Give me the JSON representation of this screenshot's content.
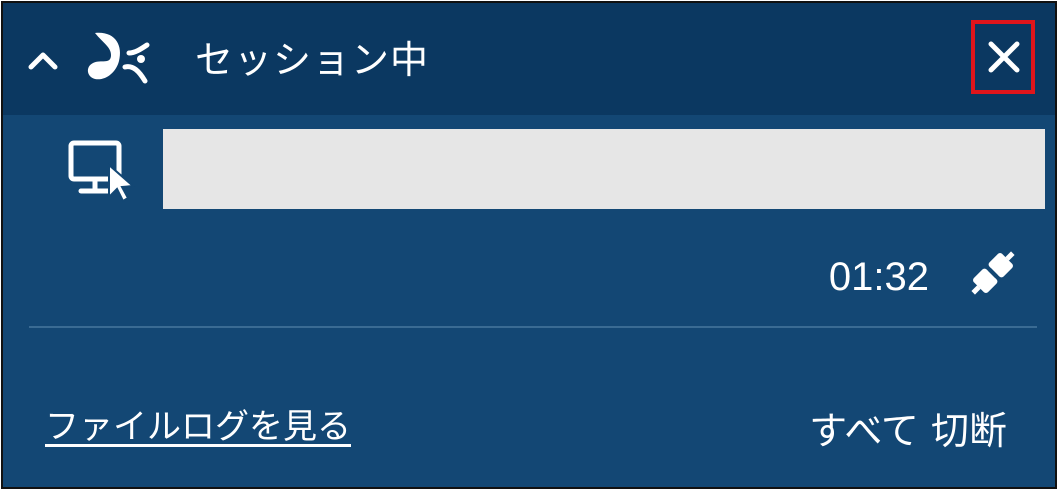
{
  "header": {
    "collapse_icon": "chevron-up-icon",
    "logo_icon": "splashtop-logo-icon",
    "status_title": "セッション中",
    "close_icon": "close-icon",
    "background": "#0b3861"
  },
  "session": {
    "icon": "remote-desktop-monitor-icon",
    "name_value": "",
    "timer": "01:32",
    "connection_icon": "plug-connection-icon"
  },
  "footer": {
    "file_log_link": "ファイルログを見る",
    "disconnect_all": "すべて 切断"
  },
  "colors": {
    "panel_bg": "#134774",
    "highlight_border": "#e0151b",
    "input_bg": "#e6e6e6"
  }
}
